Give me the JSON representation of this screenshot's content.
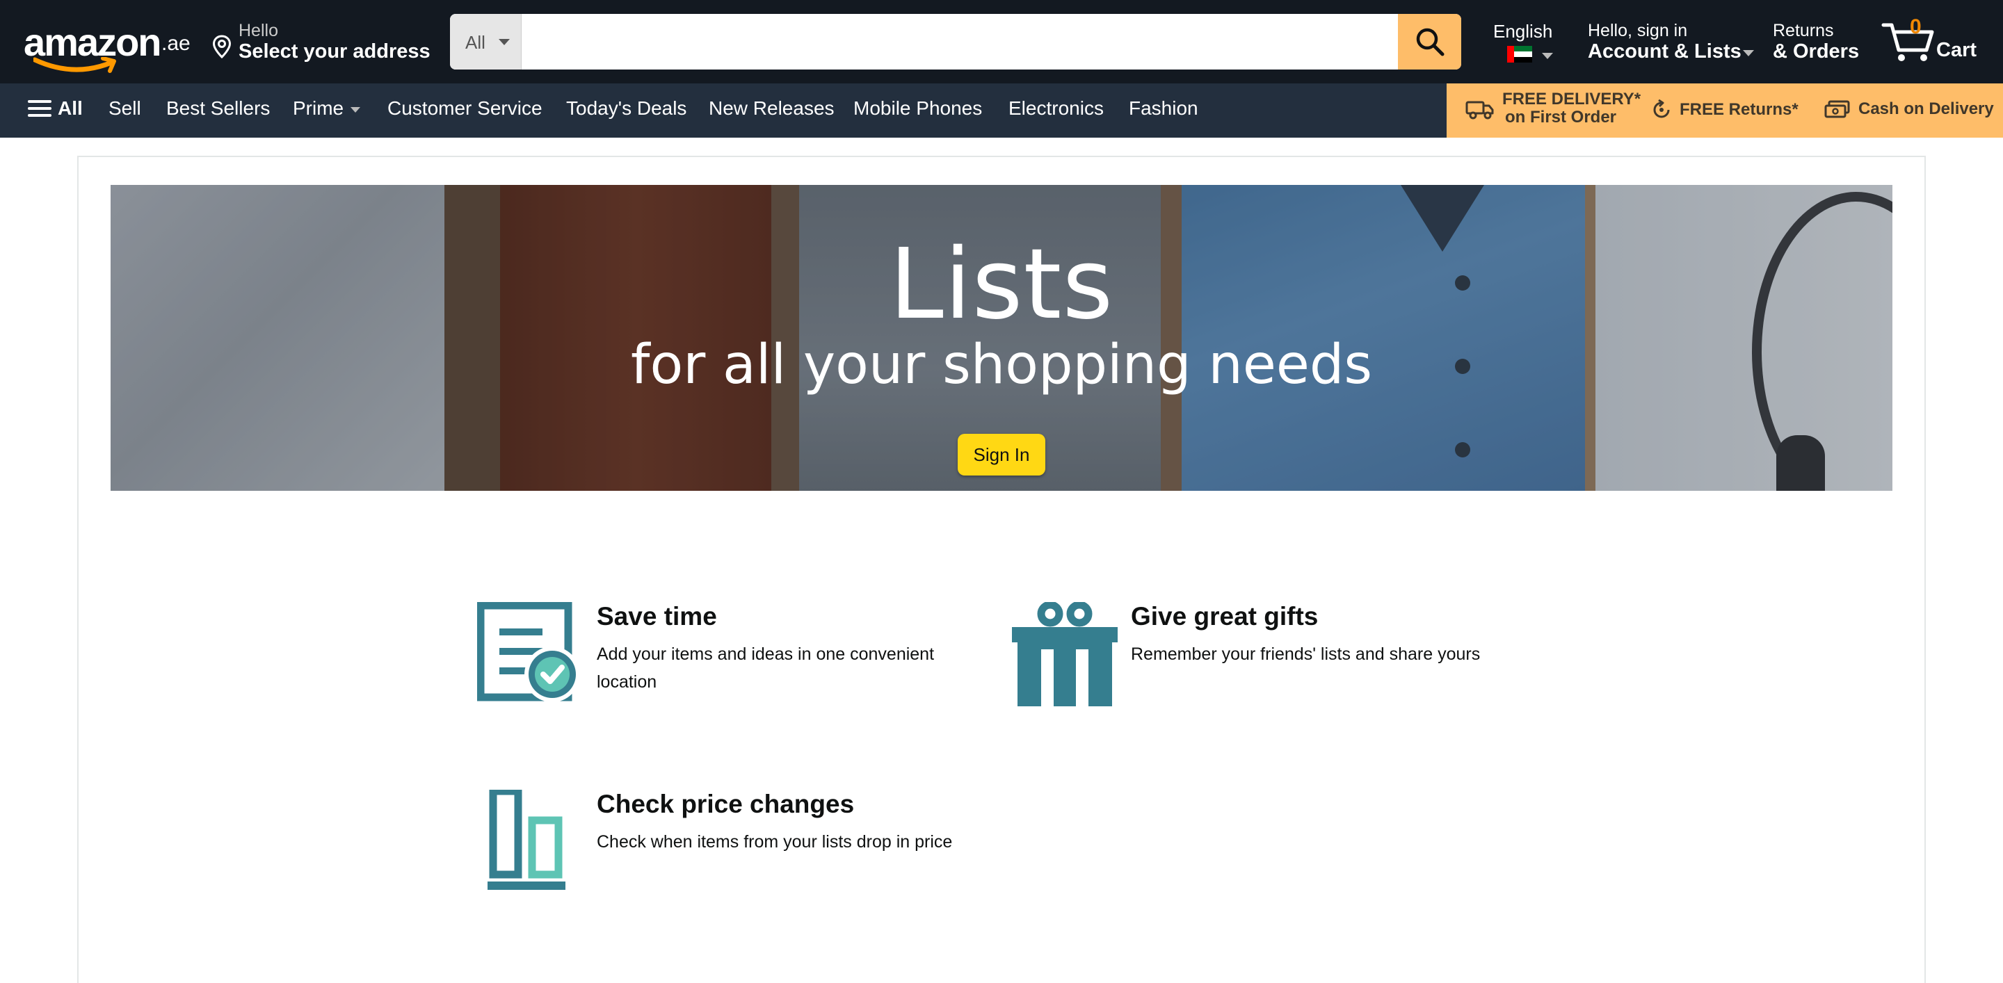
{
  "header": {
    "logo_text": "amazon",
    "logo_tld": ".ae",
    "deliver_line1": "Hello",
    "deliver_line2": "Select your address",
    "search": {
      "category": "All",
      "placeholder": "",
      "value": ""
    },
    "language": "English",
    "account_line1": "Hello, sign in",
    "account_line2": "Account & Lists",
    "returns_line1": "Returns",
    "returns_line2": "& Orders",
    "cart_count": "0",
    "cart_label": "Cart",
    "accent_color": "#febd69",
    "cart_count_color": "#f08804"
  },
  "subnav": {
    "all_label": "All",
    "items": [
      "Sell",
      "Best Sellers",
      "Prime",
      "Customer Service",
      "Today's Deals",
      "New Releases",
      "Mobile Phones",
      "Electronics",
      "Fashion"
    ],
    "promos": {
      "delivery_line1": "FREE DELIVERY*",
      "delivery_line2": "on First Order",
      "returns": "FREE Returns*",
      "cod": "Cash on Delivery"
    }
  },
  "hero": {
    "title": "Lists",
    "subtitle": "for all your shopping needs",
    "signin_label": "Sign In"
  },
  "features": [
    {
      "title": "Save time",
      "desc": "Add your items and ideas in one convenient location",
      "icon": "list-check-icon"
    },
    {
      "title": "Give great gifts",
      "desc": "Remember your friends' lists and share yours",
      "icon": "gift-icon"
    },
    {
      "title": "Check price changes",
      "desc": "Check when items from your lists drop in price",
      "icon": "price-bars-icon"
    }
  ],
  "colors": {
    "icon_teal": "#357e8f",
    "icon_light_teal": "#5ec4b4",
    "sign_in_yellow": "#ffd814"
  }
}
